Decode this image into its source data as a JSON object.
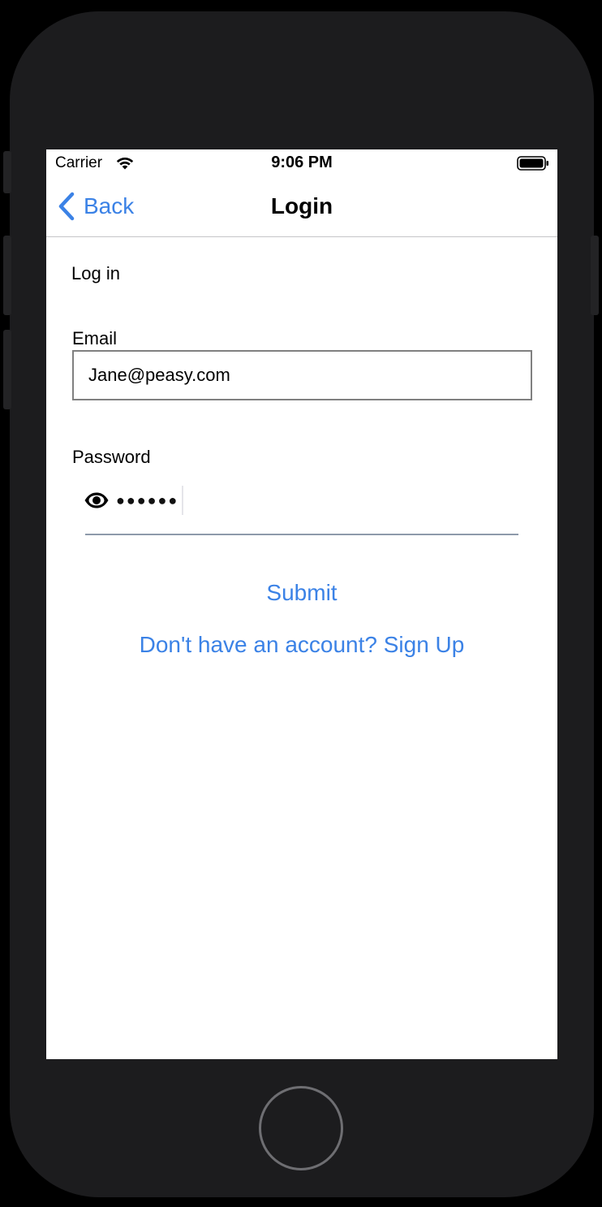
{
  "status_bar": {
    "carrier": "Carrier",
    "time": "9:06 PM",
    "icons": [
      "wifi-icon",
      "battery-icon"
    ]
  },
  "nav": {
    "back_label": "Back",
    "title": "Login",
    "icon": "chevron-left-icon"
  },
  "form": {
    "section_title": "Log in",
    "email_label": "Email",
    "email_value": "Jane@peasy.com",
    "password_label": "Password",
    "password_value": "●●●●●●",
    "password_icon": "eye-icon"
  },
  "actions": {
    "submit_label": "Submit",
    "signup_label": "Don't have an account? Sign Up"
  },
  "colors": {
    "accent": "#3b82e6",
    "device_body": "#1c1c1e",
    "screen_bg": "#ffffff"
  }
}
